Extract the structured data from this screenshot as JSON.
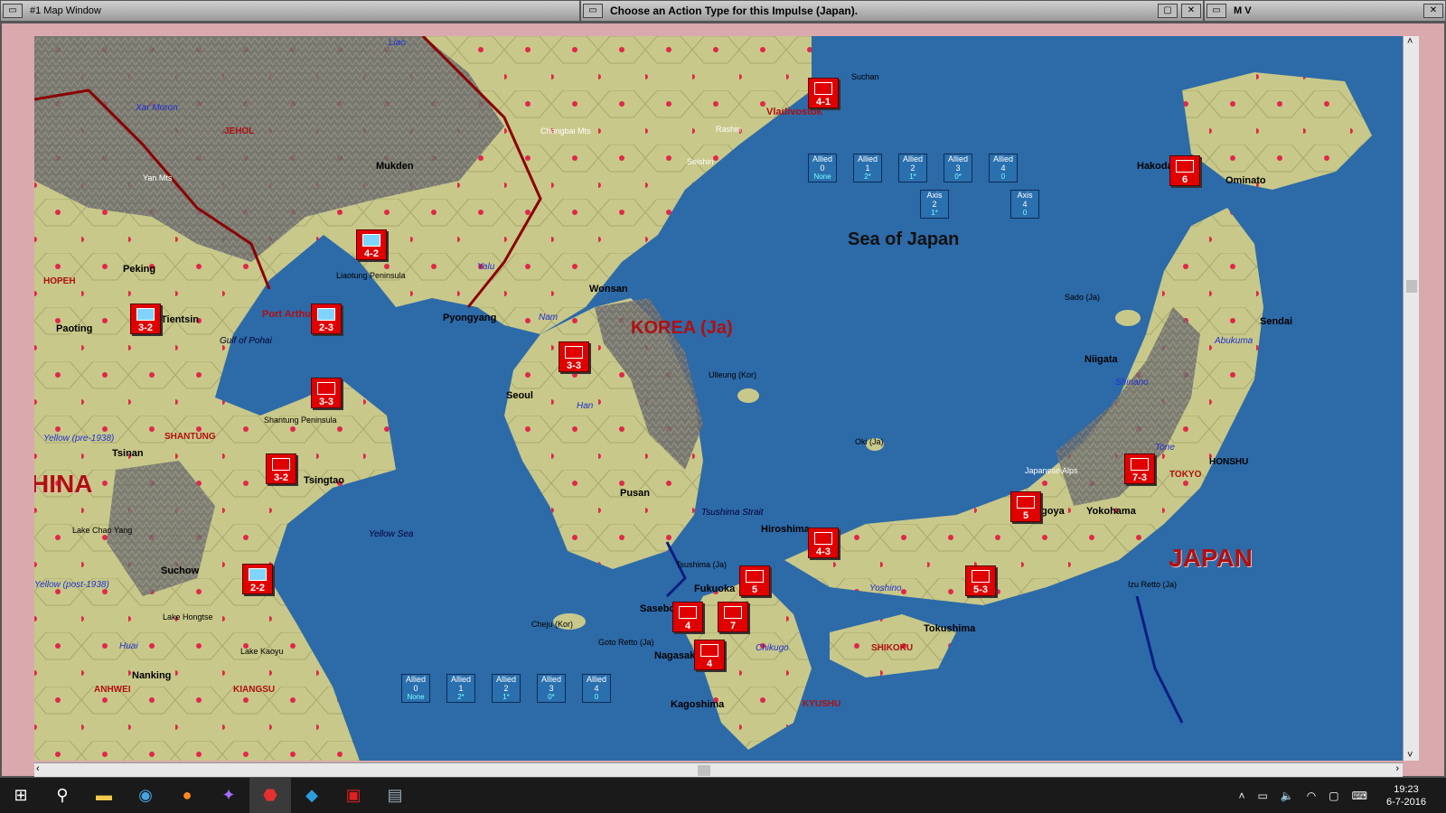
{
  "windows": {
    "map_title": "#1 Map Window",
    "action_title": "Choose an Action Type for this Impulse (Japan).",
    "mv_title": "M V"
  },
  "map": {
    "regions": [
      "KOREA (Ja)",
      "JAPAN",
      "HINA"
    ],
    "seas": [
      "Sea of Japan",
      "Yellow Sea",
      "Gulf of Pohai",
      "Tsushima Strait"
    ],
    "provinces": [
      "JEHOL",
      "HOPEH",
      "SHANTUNG",
      "ANHWEI",
      "KIANGSU",
      "SHIKOKU",
      "KYUSHU",
      "HONSHU",
      "TOKYO"
    ],
    "cities": [
      "Mukden",
      "Peking",
      "Tientsin",
      "Paoting",
      "Port Arthur",
      "Pyongyang",
      "Seoul",
      "Wonsan",
      "Pusan",
      "Tsingtao",
      "Tsinan",
      "Suchow",
      "Nanking",
      "Hiroshima",
      "Fukuoka",
      "Nagasaki",
      "Kagoshima",
      "Tokushima",
      "Yokohama",
      "Nagoya",
      "Niigata",
      "Sendai",
      "Hakodate",
      "Ominato",
      "Vladivostok",
      "Sasebo"
    ],
    "terrain_labels": [
      "Changbai Mts",
      "Yan Mts",
      "Liaotung Peninsula",
      "Shantung Peninsula",
      "Japanese Alps",
      "Ulleung (Kor)",
      "Oki (Ja)",
      "Sado (Ja)",
      "Cheju (Kor)",
      "Goto Retto (Ja)",
      "Izu Retto (Ja)",
      "Tsushima (Ja)",
      "Lake Chao Yang",
      "Lake Hongtse",
      "Lake Kaoyu",
      "Rashin",
      "Seishin",
      "Suchan"
    ],
    "rivers": [
      "Liao",
      "Xar Moron",
      "Yalu",
      "Nam",
      "Han",
      "Yellow (pre-1938)",
      "Yellow (post-1938)",
      "Huai",
      "Yoshino",
      "Chikugo",
      "Shinano",
      "Abukuma",
      "Tone"
    ]
  },
  "counters": [
    {
      "label": "4-1"
    },
    {
      "label": "4-2"
    },
    {
      "label": "3-2"
    },
    {
      "label": "2-3"
    },
    {
      "label": "3-3"
    },
    {
      "label": "3-3"
    },
    {
      "label": "3-2"
    },
    {
      "label": "2-2"
    },
    {
      "label": "4-3"
    },
    {
      "label": "5-3"
    },
    {
      "label": "7-3"
    },
    {
      "label": "6"
    },
    {
      "label": "5"
    },
    {
      "label": "5"
    },
    {
      "label": "4"
    },
    {
      "label": "7"
    },
    {
      "label": "4"
    }
  ],
  "boxes_top": [
    {
      "side": "Allied",
      "num": "0",
      "sub": "None"
    },
    {
      "side": "Allied",
      "num": "1",
      "sub": "2*"
    },
    {
      "side": "Allied",
      "num": "2",
      "sub": "1*"
    },
    {
      "side": "Allied",
      "num": "3",
      "sub": "0*"
    },
    {
      "side": "Allied",
      "num": "4",
      "sub": "0"
    }
  ],
  "boxes_axis": [
    {
      "side": "Axis",
      "num": "2",
      "sub": "1*"
    },
    {
      "side": "Axis",
      "num": "4",
      "sub": "0"
    }
  ],
  "boxes_bottom": [
    {
      "side": "Allied",
      "num": "0",
      "sub": "None"
    },
    {
      "side": "Allied",
      "num": "1",
      "sub": "2*"
    },
    {
      "side": "Allied",
      "num": "2",
      "sub": "1*"
    },
    {
      "side": "Allied",
      "num": "3",
      "sub": "0*"
    },
    {
      "side": "Allied",
      "num": "4",
      "sub": "0"
    }
  ],
  "taskbar": {
    "time": "19:23",
    "date": "6-7-2016",
    "apps": [
      "start",
      "search",
      "explorer",
      "browser",
      "firefox",
      "game-a",
      "wif",
      "app-blue",
      "pdf",
      "app-doc"
    ]
  },
  "colors": {
    "sea": "#2d6aa8",
    "land": "#c9c98a",
    "mountain": "#6b6b6b",
    "frame": "#d9a9ad",
    "japan_unit": "#e00000"
  }
}
